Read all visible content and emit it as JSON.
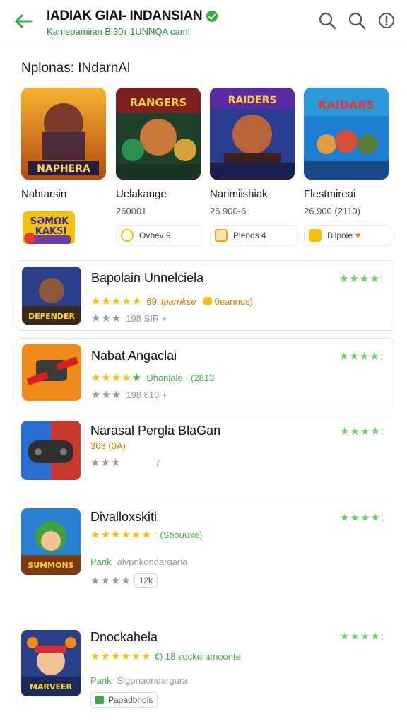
{
  "header": {
    "title": "IADIAK GIAI- INDANSIAN",
    "subtitle": "Kanlepamiian Bl30т 1UNNQA camI"
  },
  "section": {
    "title": "Nplonas: INdarnAl"
  },
  "featured": [
    {
      "art_text": "NAPHERA",
      "name": "Nahtarsin",
      "size": "",
      "chip": "",
      "logo_text": "SƏMΩK KAKSI"
    },
    {
      "art_text": "RANGERS",
      "name": "Uelakange",
      "size": "260001",
      "chip": "Ovbev 9"
    },
    {
      "art_text": "RAIDERS",
      "name": "Narimiishiak",
      "size": "26.900-6",
      "chip": "Plends 4"
    },
    {
      "art_text": "RAIDARS",
      "name": "Flestmireai",
      "size": "26.900   (2110)",
      "chip": "Bilpoie"
    }
  ],
  "list": [
    {
      "name": "Bapolain Unnelciela",
      "row1_extra": "Iparnkse",
      "row1_tag": "0eannus)",
      "row1_prefix": "69",
      "row2": "198   SIR   +",
      "art_text": "DEFENDER",
      "right_rating": "4.5"
    },
    {
      "name": "Nabat Angaclai",
      "row1_extra": "Dhonlale  · (2813",
      "row2": "198   610   +",
      "art_text": "",
      "right_rating": "4.5"
    },
    {
      "name": "Narasal Pergla BlaGan",
      "row1_extra": "363 (0A)",
      "row2": "7",
      "art_text": "",
      "right_rating": "4.5"
    },
    {
      "name": "Divalloxskiti",
      "row1_extra": "(Sbouuxe)",
      "row2_label": "Parik",
      "row2": "alvpnkondargaria",
      "row3": "12k",
      "art_text": "SUMMONS",
      "right_rating": "4.5"
    },
    {
      "name": "Dnockahela",
      "row1_extra": "€)  18  sockeramoonte",
      "row2_label": "Parik",
      "row2": "Slgpnaondargura",
      "row3": "Papadbnols",
      "art_text": "MARVEER",
      "right_rating": "4.5"
    }
  ],
  "colors": {
    "accent": "#3aa84a",
    "star": "#f4c20d"
  }
}
